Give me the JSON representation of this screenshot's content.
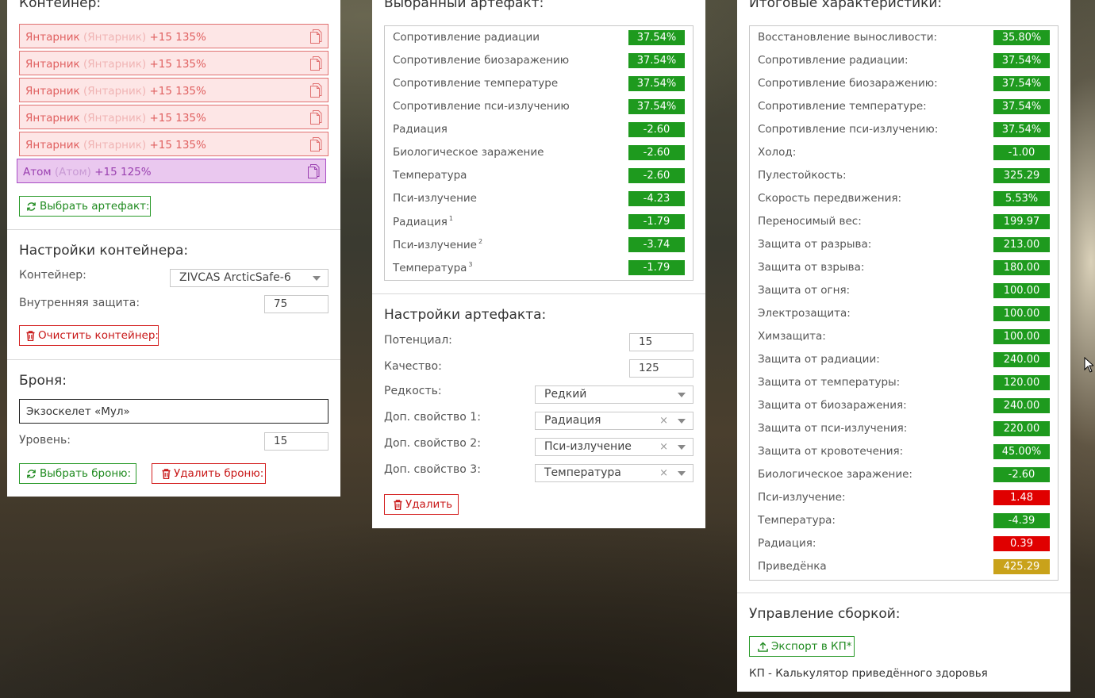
{
  "container_panel": {
    "title": "Контейнер:",
    "artifacts": [
      {
        "name": "Янтарник",
        "sub": "(Янтарник)",
        "stats": "+15 135%"
      },
      {
        "name": "Янтарник",
        "sub": "(Янтарник)",
        "stats": "+15 135%"
      },
      {
        "name": "Янтарник",
        "sub": "(Янтарник)",
        "stats": "+15 135%"
      },
      {
        "name": "Янтарник",
        "sub": "(Янтарник)",
        "stats": "+15 135%"
      },
      {
        "name": "Янтарник",
        "sub": "(Янтарник)",
        "stats": "+15 135%"
      },
      {
        "name": "Атом",
        "sub": "(Атом)",
        "stats": "+15 125%"
      }
    ],
    "select_artifact_label": "Выбрать артефакт:",
    "settings_title": "Настройки контейнера:",
    "container_label": "Контейнер:",
    "container_value": "ZIVCAS ArcticSafe-6",
    "inner_protection_label": "Внутренняя защита:",
    "inner_protection_value": "75",
    "clear_label": "Очистить контейнер:",
    "armor_title": "Броня:",
    "armor_value": "Экзоскелет «Мул»",
    "level_label": "Уровень:",
    "level_value": "15",
    "select_armor_label": "Выбрать броню:",
    "delete_armor_label": "Удалить броню:"
  },
  "artifact_panel": {
    "title": "Выбранный артефакт:",
    "stats": [
      {
        "label": "Сопротивление радиации",
        "sup": "",
        "value": "37.54%",
        "color": "#1e9a1e"
      },
      {
        "label": "Сопротивление биозаражению",
        "sup": "",
        "value": "37.54%",
        "color": "#1e9a1e"
      },
      {
        "label": "Сопротивление температуре",
        "sup": "",
        "value": "37.54%",
        "color": "#1e9a1e"
      },
      {
        "label": "Сопротивление пси-излучению",
        "sup": "",
        "value": "37.54%",
        "color": "#1e9a1e"
      },
      {
        "label": "Радиация",
        "sup": "",
        "value": "-2.60",
        "color": "#1e9a1e"
      },
      {
        "label": "Биологическое заражение",
        "sup": "",
        "value": "-2.60",
        "color": "#1e9a1e"
      },
      {
        "label": "Температура",
        "sup": "",
        "value": "-2.60",
        "color": "#1e9a1e"
      },
      {
        "label": "Пси-излучение",
        "sup": "",
        "value": "-4.23",
        "color": "#1e9a1e"
      },
      {
        "label": "Радиация",
        "sup": "1",
        "value": "-1.79",
        "color": "#1e9a1e"
      },
      {
        "label": "Пси-излучение",
        "sup": "2",
        "value": "-3.74",
        "color": "#1e9a1e"
      },
      {
        "label": "Температура",
        "sup": "3",
        "value": "-1.79",
        "color": "#1e9a1e"
      }
    ],
    "settings_title": "Настройки артефакта:",
    "potential_label": "Потенциал:",
    "potential_value": "15",
    "quality_label": "Качество:",
    "quality_value": "125",
    "rarity_label": "Редкость:",
    "rarity_value": "Редкий",
    "extra1_label": "Доп. свойство 1:",
    "extra1_value": "Радиация",
    "extra2_label": "Доп. свойство 2:",
    "extra2_value": "Пси-излучение",
    "extra3_label": "Доп. свойство 3:",
    "extra3_value": "Температура",
    "clear_glyph": "×",
    "delete_label": "Удалить"
  },
  "totals_panel": {
    "title": "Итоговые характеристики:",
    "stats": [
      {
        "label": "Восстановление выносливости:",
        "value": "35.80%",
        "color": "#1e9a1e"
      },
      {
        "label": "Сопротивление радиации:",
        "value": "37.54%",
        "color": "#1e9a1e"
      },
      {
        "label": "Сопротивление биозаражению:",
        "value": "37.54%",
        "color": "#1e9a1e"
      },
      {
        "label": "Сопротивление температуре:",
        "value": "37.54%",
        "color": "#1e9a1e"
      },
      {
        "label": "Сопротивление пси-излучению:",
        "value": "37.54%",
        "color": "#1e9a1e"
      },
      {
        "label": "Холод:",
        "value": "-1.00",
        "color": "#1e9a1e"
      },
      {
        "label": "Пулестойкость:",
        "value": "325.29",
        "color": "#1e9a1e"
      },
      {
        "label": "Скорость передвижения:",
        "value": "5.53%",
        "color": "#1e9a1e"
      },
      {
        "label": "Переносимый вес:",
        "value": "199.97",
        "color": "#1e9a1e"
      },
      {
        "label": "Защита от разрыва:",
        "value": "213.00",
        "color": "#1e9a1e"
      },
      {
        "label": "Защита от взрыва:",
        "value": "180.00",
        "color": "#1e9a1e"
      },
      {
        "label": "Защита от огня:",
        "value": "100.00",
        "color": "#1e9a1e"
      },
      {
        "label": "Электрозащита:",
        "value": "100.00",
        "color": "#1e9a1e"
      },
      {
        "label": "Химзащита:",
        "value": "100.00",
        "color": "#1e9a1e"
      },
      {
        "label": "Защита от радиации:",
        "value": "240.00",
        "color": "#1e9a1e"
      },
      {
        "label": "Защита от температуры:",
        "value": "120.00",
        "color": "#1e9a1e"
      },
      {
        "label": "Защита от биозаражения:",
        "value": "240.00",
        "color": "#1e9a1e"
      },
      {
        "label": "Защита от пси-излучения:",
        "value": "220.00",
        "color": "#1e9a1e"
      },
      {
        "label": "Защита от кровотечения:",
        "value": "45.00%",
        "color": "#1e9a1e"
      },
      {
        "label": "Биологическое заражение:",
        "value": "-2.60",
        "color": "#1e9a1e"
      },
      {
        "label": "Пси-излучение:",
        "value": "1.48",
        "color": "#e00000"
      },
      {
        "label": "Температура:",
        "value": "-4.39",
        "color": "#1e9a1e"
      },
      {
        "label": "Радиация:",
        "value": "0.39",
        "color": "#e00000"
      },
      {
        "label": "Приведёнка",
        "value": "425.29",
        "color": "#c9a21a"
      }
    ],
    "build_title": "Управление сборкой:",
    "export_label": "Экспорт в КП*",
    "footnote": "КП - Калькулятор приведённого здоровья"
  }
}
